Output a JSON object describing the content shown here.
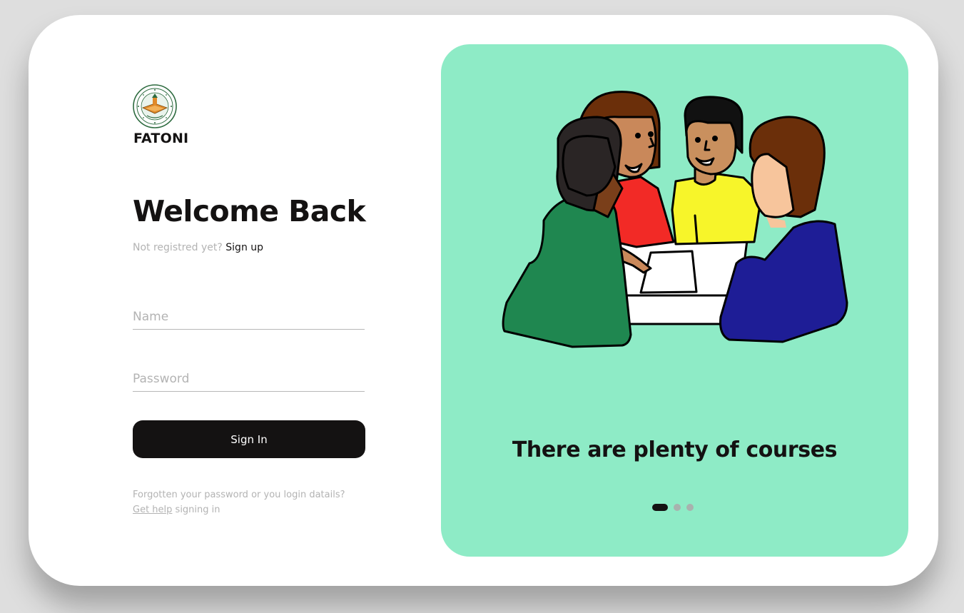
{
  "brand": {
    "name": "FATONI",
    "logo_icon": "university-seal-icon"
  },
  "login": {
    "title": "Welcome Back",
    "not_registered": "Not registred yet?",
    "signup_link": "Sign up",
    "name_placeholder": "Name",
    "password_placeholder": "Password",
    "signin_label": "Sign In",
    "help_text_1": "Forgotten your password or you login datails?",
    "help_link": "Get help",
    "help_text_2": "signing in"
  },
  "carousel": {
    "illustration_icon": "students-group-illustration",
    "tagline": "There are plenty of courses",
    "slide_count": 3,
    "active_slide": 1
  },
  "colors": {
    "accent_panel": "#8eebc6",
    "primary_button": "#141212",
    "muted_text": "#b3b3b3"
  }
}
